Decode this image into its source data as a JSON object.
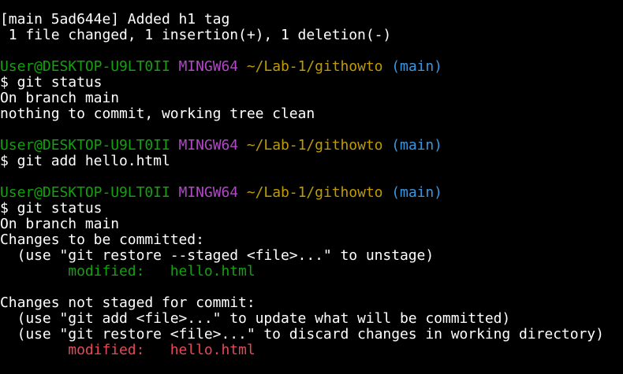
{
  "colors": {
    "background": "#000000",
    "text": "#ffffff",
    "user": "#13a10e",
    "host": "#b148c6",
    "path": "#c19c00",
    "branch": "#3a96dd",
    "staged": "#13a10e",
    "unstaged": "#e74856"
  },
  "prompt": {
    "user": "User@DESKTOP-U9LT0II",
    "host": "MINGW64",
    "path": "~/Lab-1/githowto",
    "branch": "(main)"
  },
  "lines": {
    "commit_summary": "[main 5ad644e] Added h1 tag",
    "commit_stats": " 1 file changed, 1 insertion(+), 1 deletion(-)",
    "cmd1": "$ git status",
    "status1_branch": "On branch main",
    "status1_clean": "nothing to commit, working tree clean",
    "cmd2": "$ git add hello.html",
    "cmd3": "$ git status",
    "status2_branch": "On branch main",
    "staged_header": "Changes to be committed:",
    "staged_hint": "  (use \"git restore --staged <file>...\" to unstage)",
    "staged_file_indent": "        ",
    "staged_file": "modified:   hello.html",
    "unstaged_header": "Changes not staged for commit:",
    "unstaged_hint1": "  (use \"git add <file>...\" to update what will be committed)",
    "unstaged_hint2": "  (use \"git restore <file>...\" to discard changes in working directory)",
    "unstaged_file_indent": "        ",
    "unstaged_file": "modified:   hello.html"
  }
}
